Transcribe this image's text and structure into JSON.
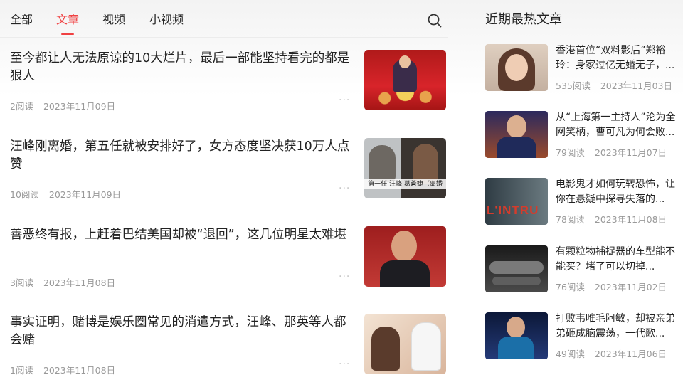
{
  "tabs": [
    {
      "label": "全部",
      "active": false
    },
    {
      "label": "文章",
      "active": true
    },
    {
      "label": "视频",
      "active": false
    },
    {
      "label": "小视频",
      "active": false
    }
  ],
  "colors": {
    "accent": "#f04142",
    "meta": "#999999",
    "text": "#222222"
  },
  "articles": [
    {
      "title": "至今都让人无法原谅的10大烂片，最后一部能坚持看完的都是狠人",
      "reads": "2阅读",
      "date": "2023年11月09日",
      "more": "···"
    },
    {
      "title": "汪峰刚离婚，第五任就被安排好了，女方态度坚决获10万人点赞",
      "reads": "10阅读",
      "date": "2023年11月09日",
      "more": "···",
      "thumb_caption": "第一任 汪峰 葛蒼婕（离婚"
    },
    {
      "title": "善恶终有报，上赶着巴结美国却被“退回”，这几位明星太难堪",
      "reads": "3阅读",
      "date": "2023年11月08日",
      "more": "···"
    },
    {
      "title": "事实证明，赌博是娱乐圈常见的消遣方式，汪峰、那英等人都会赌",
      "reads": "1阅读",
      "date": "2023年11月08日",
      "more": "···"
    }
  ],
  "sidebar": {
    "title": "近期最热文章",
    "items": [
      {
        "title": "香港首位“双料影后”郑裕玲：身家过亿无婚无子，...",
        "reads": "535阅读",
        "date": "2023年11月03日"
      },
      {
        "title": "从“上海第一主持人”沦为全网笑柄，曹可凡为何会败...",
        "reads": "79阅读",
        "date": "2023年11月07日"
      },
      {
        "title": "电影鬼才如何玩转恐怖，让你在悬疑中探寻失落的...",
        "reads": "78阅读",
        "date": "2023年11月08日",
        "thumb_text": "L'INTRU"
      },
      {
        "title": "有颗粒物捕捉器的车型能不能买？堵了可以切掉...",
        "reads": "76阅读",
        "date": "2023年11月02日"
      },
      {
        "title": "打败韦唯毛阿敏，却被亲弟弟砸成脑震荡，一代歌...",
        "reads": "49阅读",
        "date": "2023年11月06日"
      }
    ]
  }
}
